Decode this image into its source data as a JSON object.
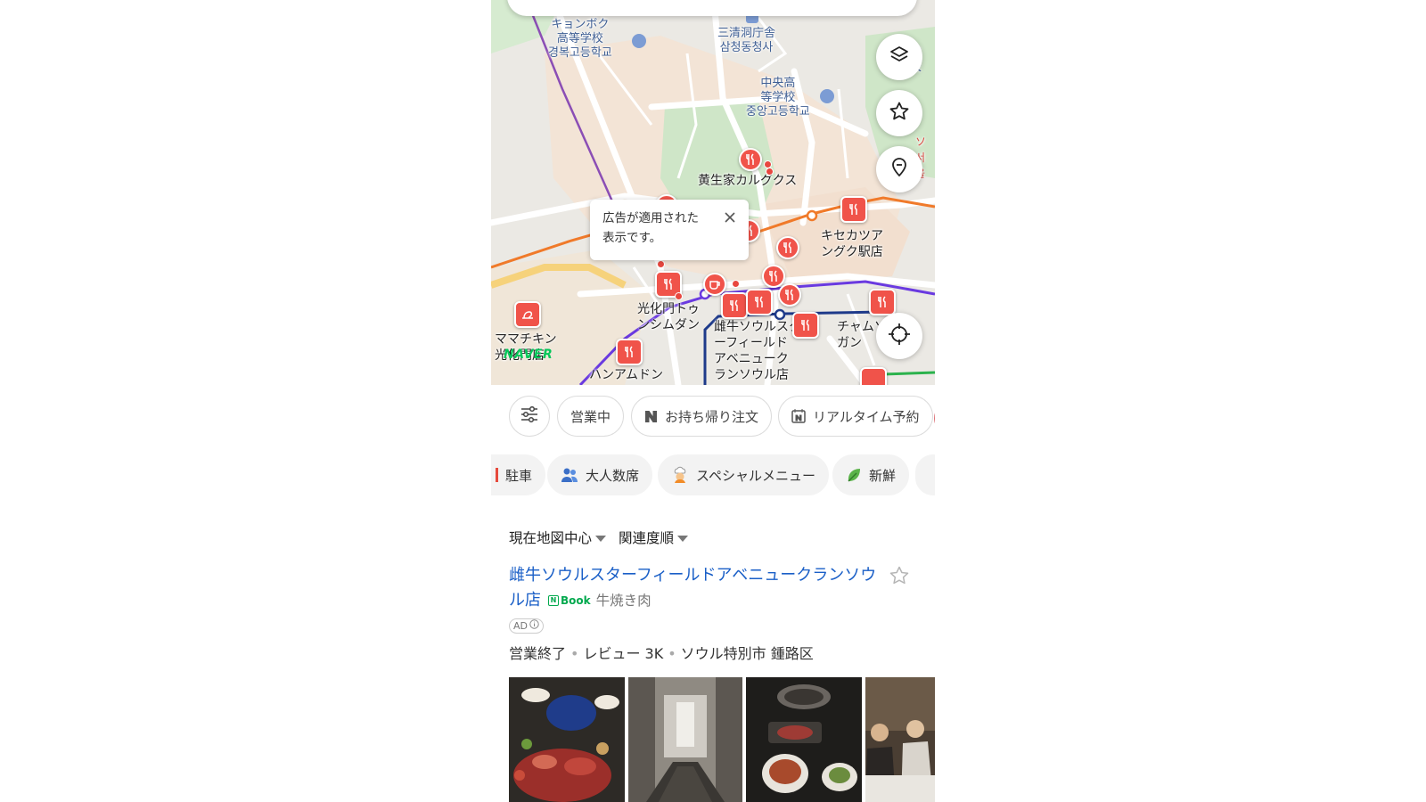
{
  "map": {
    "labels": {
      "school1": "キョンボク\n高等学校\n경복고등학교",
      "govt": "三清洞庁舎\n삼청동청사",
      "school2": "中央高\n等学校\n중앙고등학교",
      "right_edge_1": "学\n校",
      "right_edge_2": "ソ\n서울",
      "kalguksu": "黄生家カルグクス",
      "kisekatsu": "キセカツア\nングク駅店",
      "gwanghwamun": "光化門トゥ\nンシムダン",
      "chunwoo": "雌牛ソウルスタ\nーフィールド\nアベニューク\nランソウル店",
      "chae": "チャムソ\nガン",
      "mamachicken": "ママチキン\n光化門店",
      "hanamdon": "ハンアムドン"
    },
    "tooltip": "広告が適用された\n表示です。",
    "watermark": "NAVER",
    "buttons": [
      "layers-icon",
      "star-icon",
      "pin-icon",
      "locate-icon"
    ]
  },
  "filters_row1": [
    {
      "label": "",
      "icon": "sliders-icon"
    },
    {
      "label": "営業中"
    },
    {
      "label": "お持ち帰り注文",
      "icon": "naver-n-icon"
    },
    {
      "label": "リアルタイム予約",
      "icon": "naver-calendar-icon"
    }
  ],
  "filters_row2": [
    {
      "label": "駐車"
    },
    {
      "label": "大人数席",
      "icon": "people-icon"
    },
    {
      "label": "スペシャルメニュー",
      "icon": "chef-icon"
    },
    {
      "label": "新鮮",
      "icon": "leaf-icon"
    }
  ],
  "sort": {
    "location": "現在地図中心",
    "order": "関連度順"
  },
  "result": {
    "title": "雌牛ソウルスターフィールドアベニュークランソウル店",
    "badge": "Book",
    "category": "牛焼き肉",
    "ad_label": "AD",
    "status": "営業終了",
    "reviews": "レビュー 3K",
    "location": "ソウル特別市 鍾路区"
  },
  "colors": {
    "accent_blue": "#1a5fc7",
    "pin_red": "#f0534a",
    "naver_green": "#03c75a",
    "annotation_red": "#c8202a"
  }
}
